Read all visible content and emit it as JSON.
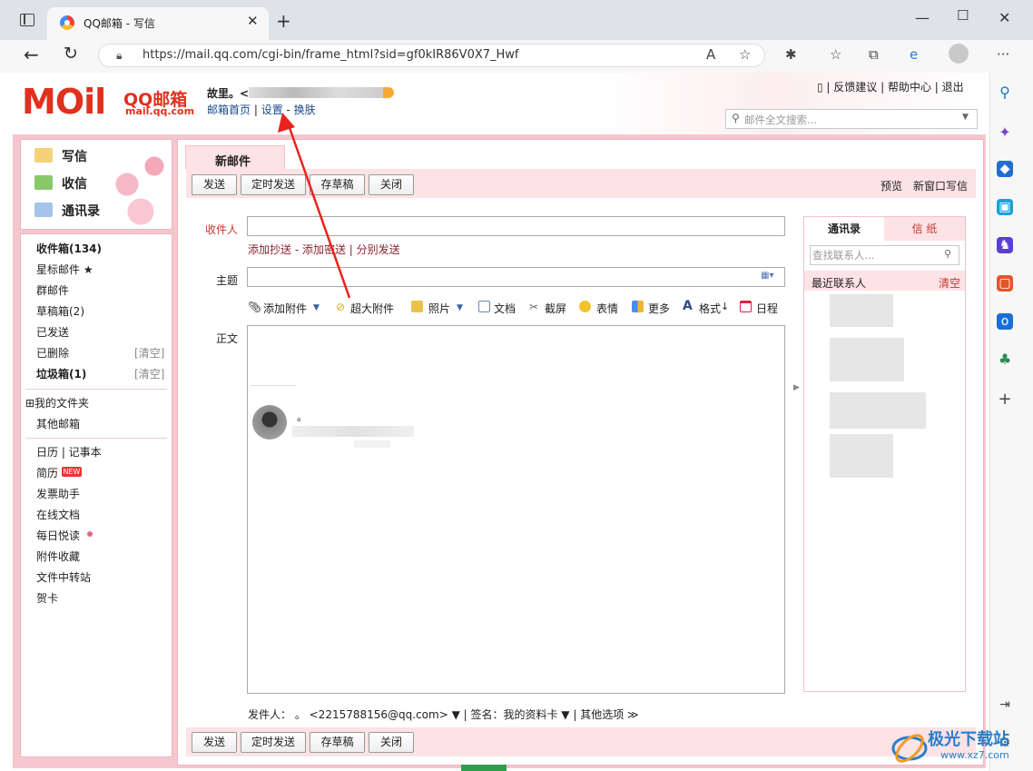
{
  "browser": {
    "tab_title": "QQ邮箱 - 写信",
    "url": "https://mail.qq.com/cgi-bin/frame_html?sid=gf0kIR86V0X7_Hwf"
  },
  "header": {
    "logo_text": "MOil",
    "logo_brand": "QQ邮箱",
    "logo_domain": "mail.qq.com",
    "username": "故里。<",
    "links": [
      "邮箱首页",
      "设置",
      "换肤"
    ],
    "right_links": [
      "反馈建议",
      "帮助中心",
      "退出"
    ],
    "search_placeholder": "邮件全文搜索..."
  },
  "leftnav": {
    "primary": [
      "写信",
      "收信",
      "通讯录"
    ],
    "folders": [
      {
        "label": "收件箱(134)",
        "bold": true
      },
      {
        "label": "星标邮件 ★"
      },
      {
        "label": "群邮件"
      },
      {
        "label": "草稿箱(2)"
      },
      {
        "label": "已发送"
      },
      {
        "label": "已删除",
        "right": "[清空]"
      },
      {
        "label": "垃圾箱(1)",
        "bold": true,
        "right": "[清空]"
      }
    ],
    "my_folders": "⊞我的文件夹",
    "other_mail": "其他邮箱",
    "apps": [
      "日历  |  记事本",
      "简历",
      "发票助手",
      "在线文档",
      "每日悦读",
      "附件收藏",
      "文件中转站",
      "贺卡"
    ],
    "new_badge": "NEW"
  },
  "compose": {
    "tab": "新邮件",
    "buttons": [
      "发送",
      "定时发送",
      "存草稿",
      "关闭"
    ],
    "preview": "预览",
    "new_window": "新窗口写信",
    "to_label": "收件人",
    "cc_links": "添加抄送 - 添加密送 | 分别发送",
    "subject_label": "主题",
    "body_label": "正文",
    "editbar": [
      "添加附件",
      "超大附件",
      "照片",
      "文档",
      "截屏",
      "表情",
      "更多",
      "格式",
      "日程"
    ],
    "signature_dot": "。",
    "sender_line": "发件人：  。 <2215788156@qq.com> ▼   |   签名：我的资料卡 ▼   |   其他选项 ≫"
  },
  "contacts": {
    "tab_contacts": "通讯录",
    "tab_stationery": "信 纸",
    "search_placeholder": "查找联系人...",
    "recent": "最近联系人",
    "clear": "清空"
  },
  "watermark": {
    "brand": "极光下载站",
    "url": "www.xz7.com"
  },
  "colors": {
    "accent_pink": "#f6c6cf",
    "logo_red": "#e0301e",
    "arrow_red": "#e8231d"
  }
}
